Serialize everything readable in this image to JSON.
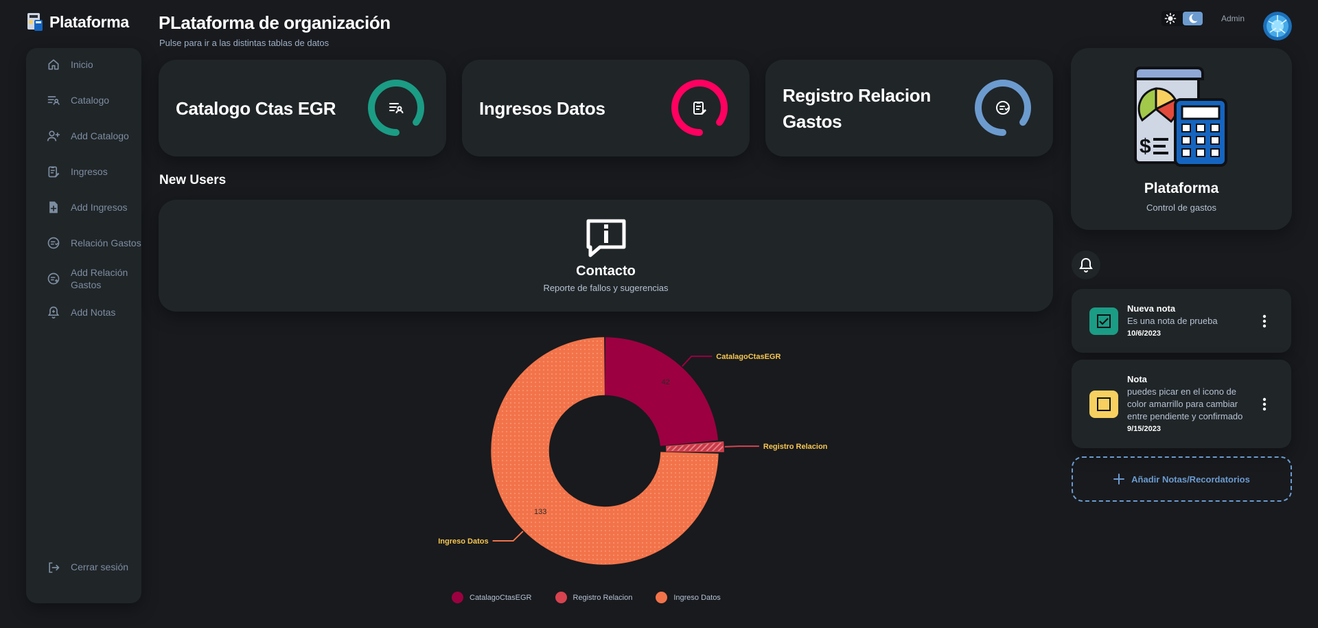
{
  "brand": {
    "title": "Plataforma"
  },
  "sidebar": {
    "items": [
      {
        "label": "Inicio",
        "icon": "home-icon"
      },
      {
        "label": "Catalogo",
        "icon": "list-user-icon"
      },
      {
        "label": "Add Catalogo",
        "icon": "person-add-icon"
      },
      {
        "label": "Ingresos",
        "icon": "clipboard-edit-icon"
      },
      {
        "label": "Add Ingresos",
        "icon": "file-add-icon"
      },
      {
        "label": "Relación Gastos",
        "icon": "coin-icon"
      },
      {
        "label": "Add Relación Gastos",
        "icon": "coin-add-icon"
      },
      {
        "label": "Add Notas",
        "icon": "bell-add-icon"
      }
    ],
    "logout": {
      "label": "Cerrar sesión",
      "icon": "logout-icon"
    }
  },
  "header": {
    "title": "PLataforma de organización",
    "subtitle": "Pulse para ir a las distintas tablas de datos",
    "admin_label": "Admin"
  },
  "cards": [
    {
      "label": "Catalogo Ctas EGR",
      "color": "#1b9c85",
      "icon": "list-user-icon"
    },
    {
      "label": "Ingresos Datos",
      "color": "#ff0060",
      "icon": "clipboard-edit-icon"
    },
    {
      "label": "Registro Relacion Gastos",
      "color": "#6c9bcf",
      "icon": "coin-icon"
    }
  ],
  "new_users": {
    "title": "New Users"
  },
  "contact": {
    "title": "Contacto",
    "subtitle": "Reporte de fallos y sugerencias",
    "icon": "info-message-icon"
  },
  "chart_data": {
    "type": "pie",
    "hole": true,
    "categories": [
      "CatalagoCtasEGR",
      "Registro Relacion",
      "Ingreso Datos"
    ],
    "values": [
      42,
      3,
      133
    ],
    "value_labels": [
      "42",
      "",
      "133"
    ],
    "colors": [
      "#9c0040",
      "#d7434f",
      "#f2734a"
    ],
    "label_color": "#f9c74f",
    "legend": "bottom"
  },
  "profile": {
    "name": "Plataforma",
    "role": "Control de gastos"
  },
  "notes": [
    {
      "title": "Nueva nota",
      "body": "Es una nota de prueba",
      "date": "10/6/2023",
      "status": "confirmado",
      "color": "#1b9c85"
    },
    {
      "title": "Nota",
      "body": "puedes picar en el icono de color amarrillo para cambiar entre pendiente y confirmado",
      "date": "9/15/2023",
      "status": "pendiente",
      "color": "#f7d060"
    }
  ],
  "add_note": {
    "label": "Añadir Notas/Recordatorios"
  },
  "accent": "#6c9bcf"
}
